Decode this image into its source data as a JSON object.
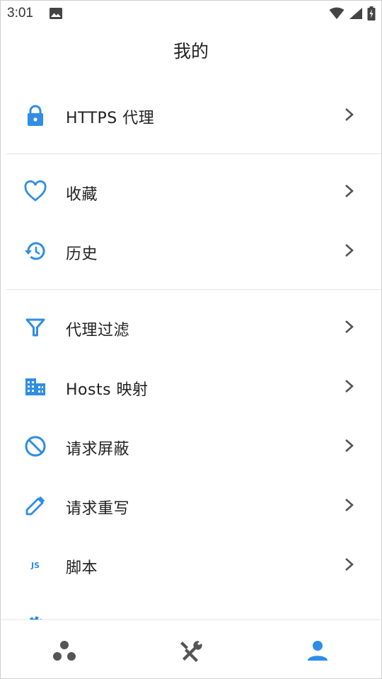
{
  "status_bar": {
    "time": "3:01",
    "icons": [
      "image-icon",
      "wifi-icon",
      "signal-icon",
      "battery-charging-icon"
    ]
  },
  "page": {
    "title": "我的"
  },
  "menu": {
    "https_proxy": {
      "label": "HTTPS 代理",
      "icon": "lock-icon"
    },
    "favorites": {
      "label": "收藏",
      "icon": "heart-icon"
    },
    "history": {
      "label": "历史",
      "icon": "history-icon"
    },
    "proxy_filter": {
      "label": "代理过滤",
      "icon": "filter-icon"
    },
    "hosts_mapping": {
      "label": "Hosts 映射",
      "icon": "building-icon"
    },
    "request_block": {
      "label": "请求屏蔽",
      "icon": "block-icon"
    },
    "request_rewrite": {
      "label": "请求重写",
      "icon": "pencil-icon"
    },
    "script": {
      "label": "脚本",
      "icon": "js-icon",
      "icon_text": "JS"
    }
  },
  "bottom_nav": {
    "items": [
      {
        "icon": "bubbles-icon",
        "active": false
      },
      {
        "icon": "tools-icon",
        "active": false
      },
      {
        "icon": "person-icon",
        "active": true
      }
    ]
  },
  "colors": {
    "accent": "#2f8de4",
    "icon_gray": "#555555",
    "divider": "#e4e4e4"
  }
}
